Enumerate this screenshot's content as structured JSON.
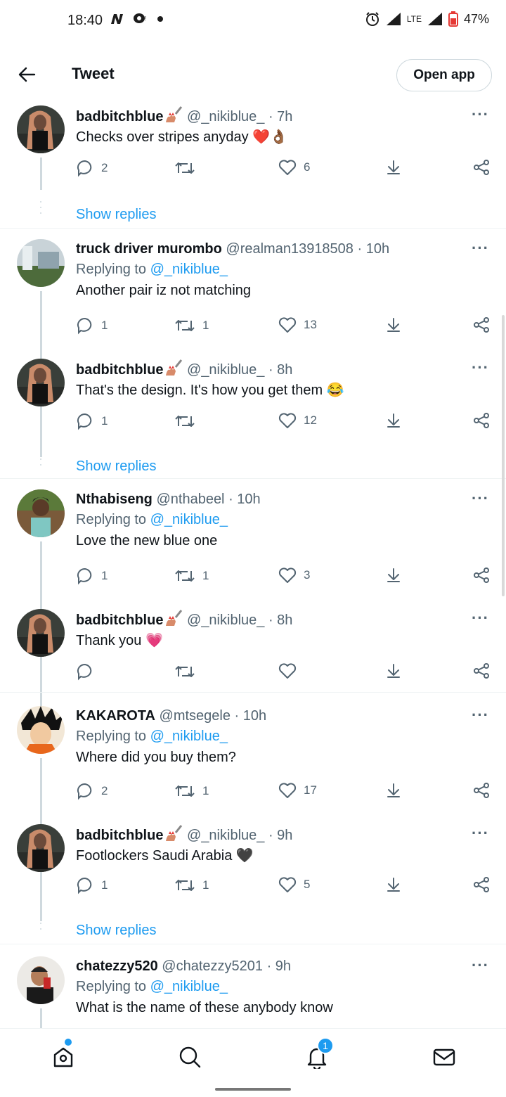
{
  "status_bar": {
    "time": "18:40",
    "battery": "47%",
    "network": "LTE"
  },
  "header": {
    "title": "Tweet",
    "open_app_label": "Open app"
  },
  "tweets": [
    {
      "name": "badbitchblue",
      "handle": "@_nikiblue_",
      "time": "· 7h",
      "text": "Checks over stripes anyday",
      "emoji": "❤️👌🏾",
      "replying_to": "",
      "replies": "2",
      "retweets": "",
      "likes": "6"
    },
    {
      "name": "truck driver murombo",
      "handle": "@realman13918508",
      "time": "· 10h",
      "text": "Another pair iz not matching",
      "emoji": "",
      "replying_to": "@_nikiblue_",
      "replies": "1",
      "retweets": "1",
      "likes": "13"
    },
    {
      "name": "badbitchblue",
      "handle": "@_nikiblue_",
      "time": "· 8h",
      "text": "That's the design. It's how you get them",
      "emoji": "😂",
      "replying_to": "",
      "replies": "1",
      "retweets": "",
      "likes": "12"
    },
    {
      "name": "Nthabiseng",
      "handle": "@nthabeel",
      "time": "· 10h",
      "text": "Love the new blue one",
      "emoji": "",
      "replying_to": "@_nikiblue_",
      "replies": "1",
      "retweets": "1",
      "likes": "3"
    },
    {
      "name": "badbitchblue",
      "handle": "@_nikiblue_",
      "time": "· 8h",
      "text": "Thank you",
      "emoji": "💗",
      "replying_to": "",
      "replies": "",
      "retweets": "",
      "likes": ""
    },
    {
      "name": "KAKAROTA",
      "handle": "@mtsegele",
      "time": "· 10h",
      "text": "Where did you buy them?",
      "emoji": "",
      "replying_to": "@_nikiblue_",
      "replies": "2",
      "retweets": "1",
      "likes": "17"
    },
    {
      "name": "badbitchblue",
      "handle": "@_nikiblue_",
      "time": "· 9h",
      "text": "Footlockers Saudi Arabia",
      "emoji": "🖤",
      "replying_to": "",
      "replies": "1",
      "retweets": "1",
      "likes": "5"
    },
    {
      "name": "chatezzy520",
      "handle": "@chatezzy5201",
      "time": "· 9h",
      "text": "What is the name of these anybody know",
      "emoji": "",
      "replying_to": "@_nikiblue_",
      "replies": "",
      "retweets": "",
      "likes": ""
    }
  ],
  "labels": {
    "replying_to_prefix": "Replying to",
    "show_replies": "Show replies",
    "more": "···",
    "name_emoji": "💅"
  },
  "nav": {
    "notifications_badge": "1"
  },
  "colors": {
    "accent": "#1d9bf0",
    "text": "#0f1419",
    "secondary": "#536471",
    "border": "#cfd9de"
  }
}
